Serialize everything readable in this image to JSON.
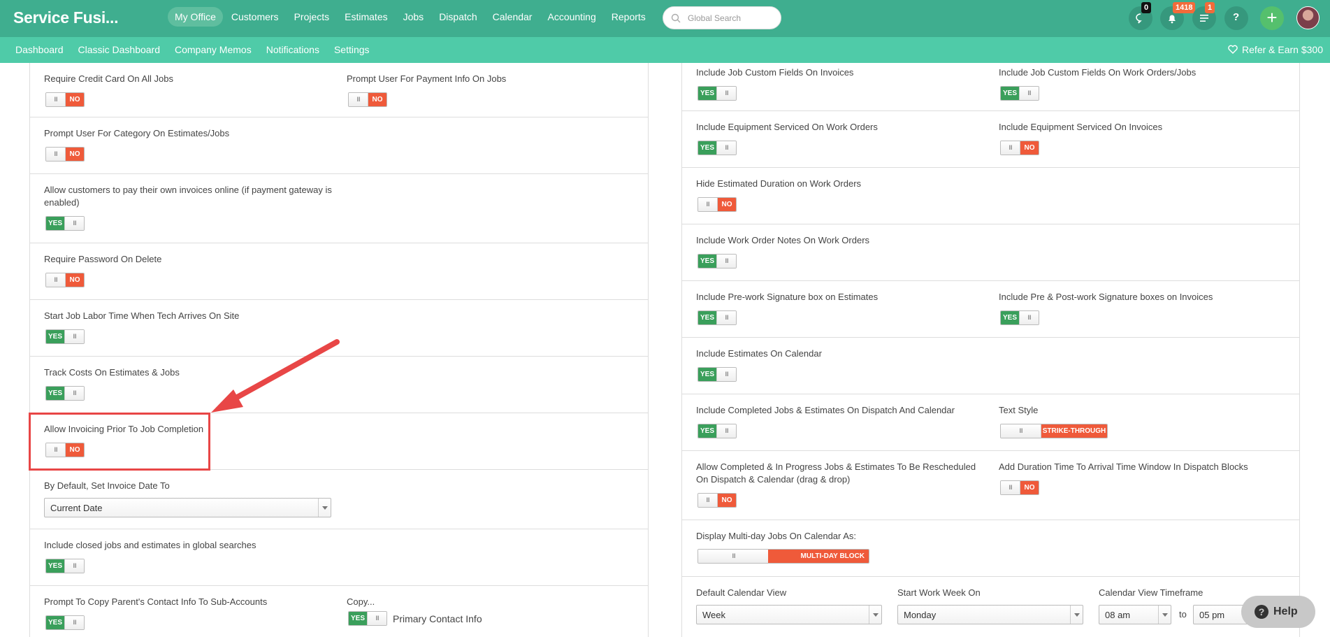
{
  "app": {
    "brand": "Service Fusi..."
  },
  "main_nav": [
    "My Office",
    "Customers",
    "Projects",
    "Estimates",
    "Jobs",
    "Dispatch",
    "Calendar",
    "Accounting",
    "Reports"
  ],
  "search": {
    "placeholder": "Global Search"
  },
  "badges": {
    "chat": "0",
    "notifications": "1418",
    "tasks": "1"
  },
  "help_icon": "?",
  "sub_nav": [
    "Dashboard",
    "Classic Dashboard",
    "Company Memos",
    "Notifications",
    "Settings"
  ],
  "refer": "Refer & Earn $300",
  "toggle_labels": {
    "yes": "YES",
    "no": "NO",
    "strike": "STRIKE-THROUGH",
    "multiday": "MULTI-DAY BLOCK",
    "grip": "III"
  },
  "left": {
    "require_cc": "Require Credit Card On All Jobs",
    "prompt_payment": "Prompt User For Payment Info On Jobs",
    "prompt_category": "Prompt User For Category On Estimates/Jobs",
    "allow_pay_online": "Allow customers to pay their own invoices online (if payment gateway is enabled)",
    "require_password": "Require Password On Delete",
    "start_labor": "Start Job Labor Time When Tech Arrives On Site",
    "track_costs": "Track Costs On Estimates & Jobs",
    "allow_invoicing": "Allow Invoicing Prior To Job Completion",
    "invoice_date_label": "By Default, Set Invoice Date To",
    "invoice_date_value": "Current Date",
    "include_closed": "Include closed jobs and estimates in global searches",
    "copy_parent": "Prompt To Copy Parent's Contact Info To Sub-Accounts",
    "copy_label": "Copy...",
    "primary_contact": "Primary Contact Info"
  },
  "right": {
    "job_custom_invoices": "Include Job Custom Fields On Invoices",
    "job_custom_workorders": "Include Job Custom Fields On Work Orders/Jobs",
    "equip_workorders": "Include Equipment Serviced On Work Orders",
    "equip_invoices": "Include Equipment Serviced On Invoices",
    "hide_duration": "Hide Estimated Duration on Work Orders",
    "wo_notes": "Include Work Order Notes On Work Orders",
    "prework_sig": "Include Pre-work Signature box on Estimates",
    "prepost_sig": "Include Pre & Post-work Signature boxes on Invoices",
    "estimates_calendar": "Include Estimates On Calendar",
    "completed_dispatch": "Include Completed Jobs & Estimates On Dispatch And Calendar",
    "text_style": "Text Style",
    "allow_reschedule": "Allow Completed & In Progress Jobs & Estimates To Be Rescheduled On Dispatch & Calendar (drag & drop)",
    "add_duration": "Add Duration Time To Arrival Time Window In Dispatch Blocks",
    "multiday_label": "Display Multi-day Jobs On Calendar As:",
    "default_view_label": "Default Calendar View",
    "default_view_value": "Week",
    "start_week_label": "Start Work Week On",
    "start_week_value": "Monday",
    "timeframe_label": "Calendar View Timeframe",
    "time_from": "08 am",
    "time_to_word": "to",
    "time_to": "05 pm"
  },
  "help": {
    "label": "Help",
    "icon": "?"
  },
  "colors": {
    "header": "#3fae8f",
    "subheader": "#4fcba8",
    "yes": "#3a9f5b",
    "no": "#ef5a3a",
    "annotation": "#e84646"
  }
}
